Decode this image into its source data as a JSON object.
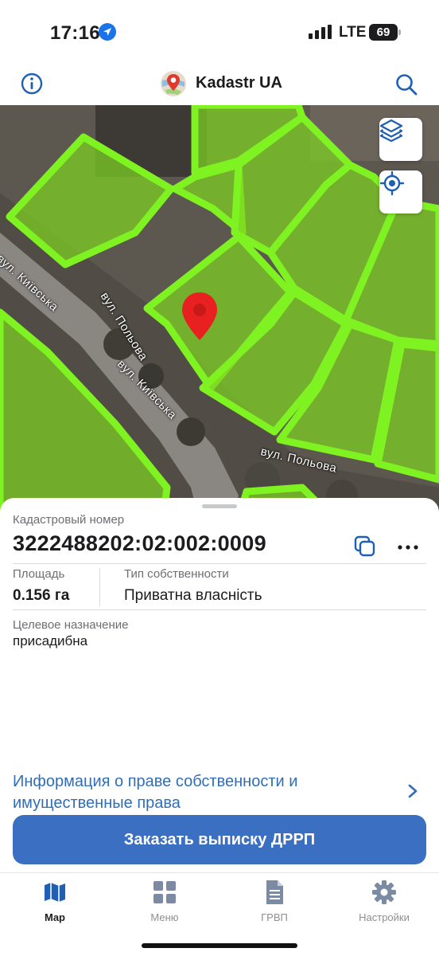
{
  "status_bar": {
    "time": "17:16",
    "network": "LTE",
    "battery": "69"
  },
  "header": {
    "title": "Kadastr UA",
    "left_icon": "info-icon",
    "right_icon": "search-icon",
    "accent_color": "#1f5fb4"
  },
  "map": {
    "street_labels": [
      "вул. Київська",
      "вул. Польова",
      "вул. Київська",
      "вул. Польова"
    ],
    "parcel_color": "#7fe81e",
    "pin_color": "#e82020",
    "controls": [
      "layers-icon",
      "locate-icon"
    ]
  },
  "parcel": {
    "cadastral_label": "Кадастровый номер",
    "cadastral_number": "3222488202:02:002:0009",
    "area_label": "Площадь",
    "area_value": "0.156 га",
    "ownership_label": "Тип собственности",
    "ownership_value": "Приватна власність",
    "purpose_label": "Целевое назначение",
    "purpose_value": "присадибна",
    "rights_link": "Информация о праве собственности и имущественные права",
    "order_button": "Заказать выписку ДРРП"
  },
  "tabbar": {
    "tabs": [
      {
        "label": "Map",
        "icon": "map-icon",
        "active": true
      },
      {
        "label": "Меню",
        "icon": "grid-icon",
        "active": false
      },
      {
        "label": "ГРВП",
        "icon": "document-icon",
        "active": false
      },
      {
        "label": "Настройки",
        "icon": "gear-icon",
        "active": false
      }
    ]
  }
}
